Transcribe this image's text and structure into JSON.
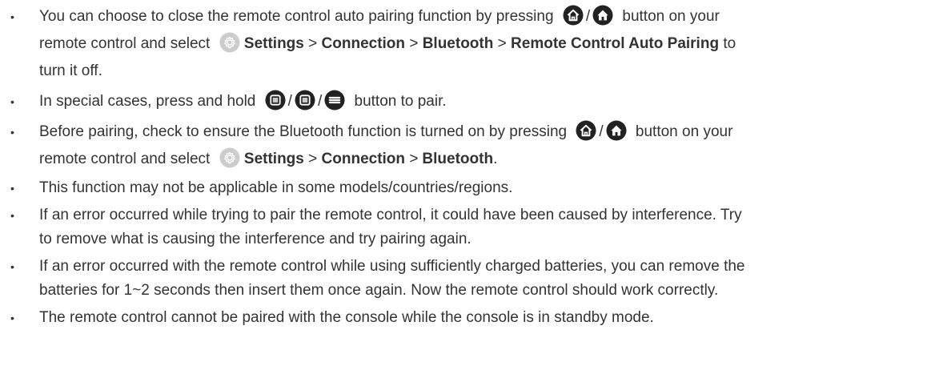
{
  "bullet_char": "•",
  "slash": "/",
  "colors": {
    "text": "#333333",
    "icon_dark": "#222222",
    "settings_icon": "#cccccc"
  },
  "icons": {
    "home": "home-icon",
    "menu": "menu-icon",
    "settings": "settings-gear-icon"
  },
  "notes": {
    "n1": {
      "a": "You can choose to close the remote control auto pairing function by pressing",
      "b": "button on your",
      "c": "remote control and select",
      "settings": "Settings",
      "sep": ">",
      "connection": "Connection",
      "bluetooth": "Bluetooth",
      "rcap": "Remote Control Auto Pairing",
      "d": "to",
      "e": "turn it off."
    },
    "n2": {
      "a": "In special cases, press and hold",
      "b": "button to pair."
    },
    "n3": {
      "a": "Before pairing, check to ensure the Bluetooth function is turned on by pressing",
      "b": "button on your",
      "c": "remote control and select",
      "settings": "Settings",
      "sep": ">",
      "connection": "Connection",
      "bluetooth": "Bluetooth",
      "end": "."
    },
    "n4": {
      "text": "This function may not be applicable in some models/countries/regions."
    },
    "n5": {
      "line1": "If an error occurred while trying to pair the remote control, it could have been caused by interference. Try",
      "line2": "to remove what is causing the interference and try pairing again."
    },
    "n6": {
      "line1": "If an error occurred with the remote control while using sufficiently charged batteries, you can remove the",
      "line2": "batteries for 1~2 seconds then insert them once again. Now the remote control should work correctly."
    },
    "n7": {
      "text": "The remote control cannot be paired with the console while the console is in standby mode."
    }
  }
}
